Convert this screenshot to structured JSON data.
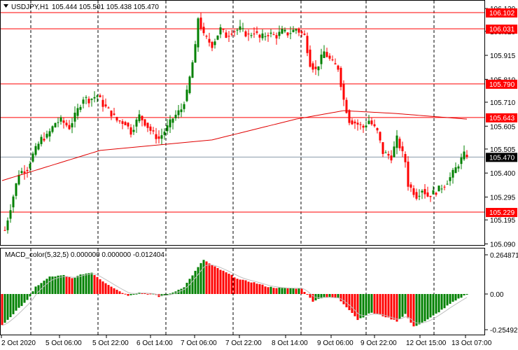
{
  "header": {
    "symbol": "USDJPY,H1",
    "ohlc": "105.444 105.501 105.438 105.470"
  },
  "macd_label": "MACD_color(5,32,5) 0.000000 0.000000 -0.012404",
  "colors": {
    "bull": "#008000",
    "bear": "#ff0000",
    "level": "#ff0000",
    "ma": "#e00000",
    "signal": "#c0c0c0"
  },
  "chart_data": [
    {
      "type": "candlestick",
      "title": "USDJPY,H1",
      "price_ticks": [
        "106.120",
        "106.020",
        "105.915",
        "105.810",
        "105.710",
        "105.605",
        "105.505",
        "105.400",
        "105.295",
        "105.195",
        "105.090"
      ],
      "levels": [
        "106.102",
        "106.031",
        "105.790",
        "105.643",
        "105.229"
      ],
      "current_price": "105.470",
      "close_waypoints": [
        [
          1,
          105.15
        ],
        [
          4,
          105.3
        ],
        [
          6,
          105.4
        ],
        [
          9,
          105.42
        ],
        [
          11,
          105.48
        ],
        [
          14,
          105.55
        ],
        [
          16,
          105.56
        ],
        [
          19,
          105.62
        ],
        [
          21,
          105.63
        ],
        [
          24,
          105.6
        ],
        [
          26,
          105.65
        ],
        [
          29,
          105.73
        ],
        [
          31,
          105.72
        ],
        [
          34,
          105.74
        ],
        [
          36,
          105.7
        ],
        [
          39,
          105.66
        ],
        [
          41,
          105.63
        ],
        [
          44,
          105.62
        ],
        [
          46,
          105.58
        ],
        [
          49,
          105.65
        ],
        [
          51,
          105.62
        ],
        [
          54,
          105.57
        ],
        [
          56,
          105.55
        ],
        [
          59,
          105.6
        ],
        [
          61,
          105.64
        ],
        [
          64,
          105.68
        ],
        [
          66,
          105.75
        ],
        [
          69,
          105.95
        ],
        [
          70,
          106.08
        ],
        [
          72,
          106.0
        ],
        [
          75,
          105.96
        ],
        [
          78,
          106.03
        ],
        [
          80,
          106.0
        ],
        [
          82,
          106.02
        ],
        [
          85,
          106.03
        ],
        [
          88,
          106.0
        ],
        [
          90,
          106.02
        ],
        [
          92,
          105.99
        ],
        [
          95,
          106.01
        ],
        [
          98,
          106.0
        ],
        [
          100,
          106.02
        ],
        [
          102,
          106.01
        ],
        [
          105,
          106.03
        ],
        [
          108,
          106.0
        ],
        [
          110,
          105.88
        ],
        [
          112,
          105.85
        ],
        [
          115,
          105.93
        ],
        [
          118,
          105.88
        ],
        [
          120,
          105.86
        ],
        [
          122,
          105.72
        ],
        [
          124,
          105.63
        ],
        [
          126,
          105.62
        ],
        [
          129,
          105.6
        ],
        [
          131,
          105.63
        ],
        [
          134,
          105.58
        ],
        [
          136,
          105.49
        ],
        [
          139,
          105.47
        ],
        [
          141,
          105.55
        ],
        [
          144,
          105.45
        ],
        [
          145,
          105.35
        ],
        [
          148,
          105.3
        ],
        [
          150,
          105.33
        ],
        [
          152,
          105.3
        ],
        [
          155,
          105.32
        ],
        [
          158,
          105.35
        ],
        [
          160,
          105.38
        ],
        [
          162,
          105.42
        ],
        [
          165,
          105.48
        ],
        [
          166,
          105.47
        ]
      ],
      "ma_waypoints": [
        [
          0,
          105.367
        ],
        [
          35,
          105.499
        ],
        [
          75,
          105.545
        ],
        [
          105,
          105.636
        ],
        [
          122,
          105.673
        ],
        [
          140,
          105.661
        ],
        [
          166,
          105.636
        ]
      ],
      "x_labels": [
        "2 Oct 2020",
        "5 Oct 06:00",
        "5 Oct 22:00",
        "6 Oct 14:00",
        "7 Oct 06:00",
        "7 Oct 22:00",
        "8 Oct 14:00",
        "9 Oct 06:00",
        "9 Oct 22:00",
        "12 Oct 15:00",
        "13 Oct 07:00"
      ]
    },
    {
      "type": "bar",
      "title": "MACD_color(5,32,5)",
      "ticks": [
        "0.264871",
        "0.00",
        "-0.254922"
      ],
      "ylim": [
        -0.254922,
        0.264871
      ],
      "hist_waypoints": [
        [
          0,
          -0.22
        ],
        [
          5,
          -0.12
        ],
        [
          10,
          -0.02
        ],
        [
          12,
          0.05
        ],
        [
          17,
          0.12
        ],
        [
          22,
          0.13
        ],
        [
          25,
          0.11
        ],
        [
          29,
          0.14
        ],
        [
          32,
          0.15
        ],
        [
          36,
          0.09
        ],
        [
          41,
          0.03
        ],
        [
          45,
          -0.01
        ],
        [
          49,
          0.01
        ],
        [
          54,
          0.0
        ],
        [
          56,
          -0.02
        ],
        [
          60,
          0.0
        ],
        [
          65,
          0.05
        ],
        [
          69,
          0.16
        ],
        [
          72,
          0.24
        ],
        [
          75,
          0.2
        ],
        [
          80,
          0.15
        ],
        [
          85,
          0.1
        ],
        [
          90,
          0.08
        ],
        [
          95,
          0.05
        ],
        [
          100,
          0.04
        ],
        [
          107,
          0.04
        ],
        [
          111,
          -0.05
        ],
        [
          115,
          -0.02
        ],
        [
          120,
          -0.03
        ],
        [
          125,
          -0.13
        ],
        [
          127,
          -0.18
        ],
        [
          132,
          -0.13
        ],
        [
          137,
          -0.16
        ],
        [
          141,
          -0.19
        ],
        [
          144,
          -0.14
        ],
        [
          147,
          -0.23
        ],
        [
          152,
          -0.18
        ],
        [
          160,
          -0.07
        ],
        [
          166,
          0.0
        ]
      ]
    }
  ]
}
